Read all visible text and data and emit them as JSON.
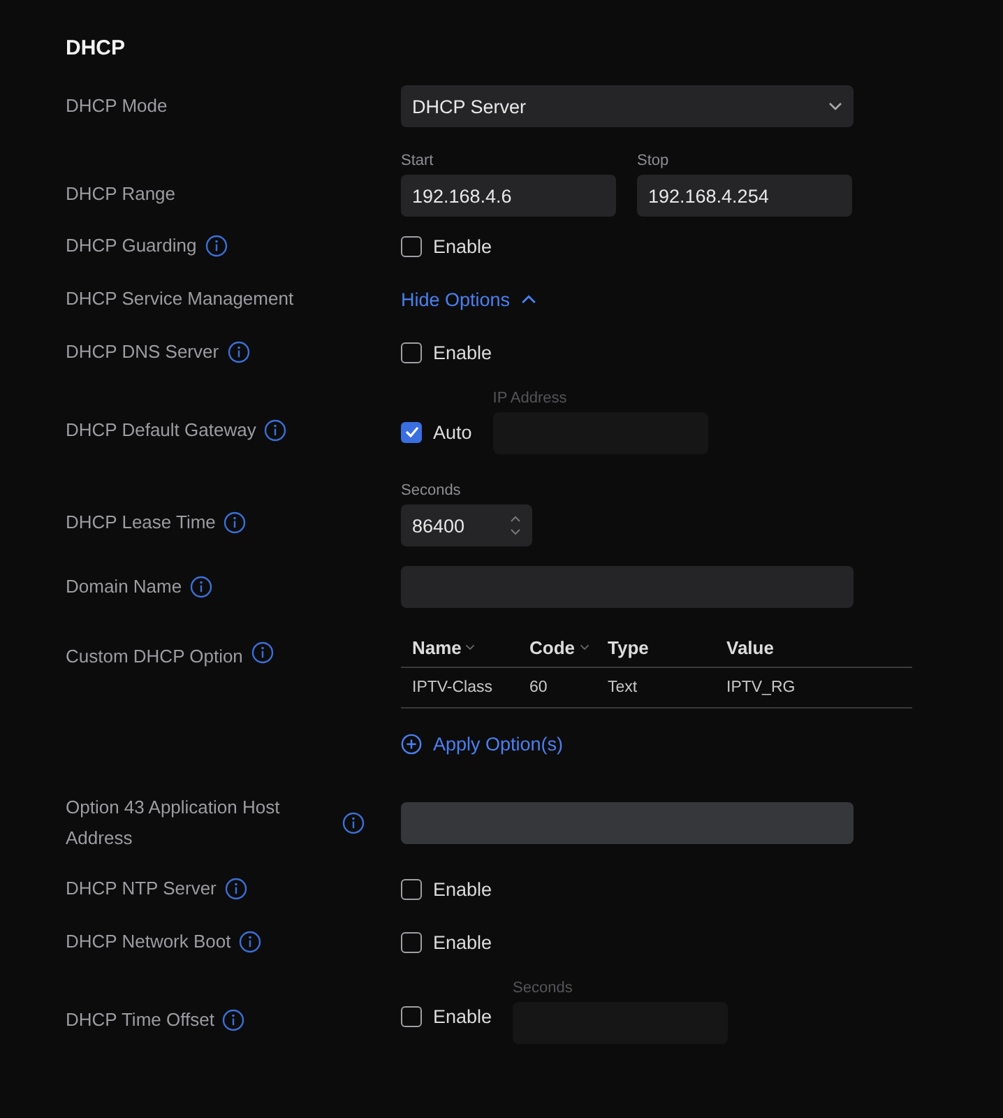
{
  "section_title": "DHCP",
  "rows": [
    {
      "kind": "select",
      "label": "DHCP Mode",
      "info": false,
      "value": "DHCP Server"
    },
    {
      "kind": "range",
      "label": "DHCP Range",
      "info": false,
      "fields": [
        {
          "caption": "Start",
          "value": "192.168.4.6"
        },
        {
          "caption": "Stop",
          "value": "192.168.4.254"
        }
      ]
    },
    {
      "kind": "checkbox",
      "label": "DHCP Guarding",
      "info": true,
      "checked": false,
      "option": "Enable"
    },
    {
      "kind": "link",
      "label": "DHCP Service Management",
      "info": false,
      "link": "Hide Options",
      "expanded": true
    },
    {
      "kind": "checkbox",
      "label": "DHCP DNS Server",
      "info": true,
      "checked": false,
      "option": "Enable"
    },
    {
      "kind": "checkfield",
      "label": "DHCP Default Gateway",
      "info": true,
      "checked": true,
      "option": "Auto",
      "caption": "IP Address",
      "disabled": true
    },
    {
      "kind": "number",
      "label": "DHCP Lease Time",
      "info": true,
      "caption": "Seconds",
      "value": "86400"
    },
    {
      "kind": "text",
      "label": "Domain Name",
      "info": true,
      "disabled": false
    },
    {
      "kind": "table",
      "label": "Custom DHCP Option",
      "info": true,
      "columns": [
        {
          "label": "Name",
          "sortable": true
        },
        {
          "label": "Code",
          "sortable": true
        },
        {
          "label": "Type",
          "sortable": false
        },
        {
          "label": "Value",
          "sortable": false
        }
      ],
      "rows": [
        [
          "IPTV-Class",
          "60",
          "Text",
          "IPTV_RG"
        ]
      ],
      "action": "Apply Option(s)"
    },
    {
      "kind": "text",
      "label": "Option 43 Application Host Address",
      "info": true,
      "disabled": false,
      "focused": true
    },
    {
      "kind": "checkbox",
      "label": "DHCP NTP Server",
      "info": true,
      "checked": false,
      "option": "Enable"
    },
    {
      "kind": "checkbox",
      "label": "DHCP Network Boot",
      "info": true,
      "checked": false,
      "option": "Enable"
    },
    {
      "kind": "checkfield",
      "label": "DHCP Time Offset",
      "info": true,
      "checked": false,
      "option": "Enable",
      "caption": "Seconds",
      "disabled": true
    }
  ]
}
